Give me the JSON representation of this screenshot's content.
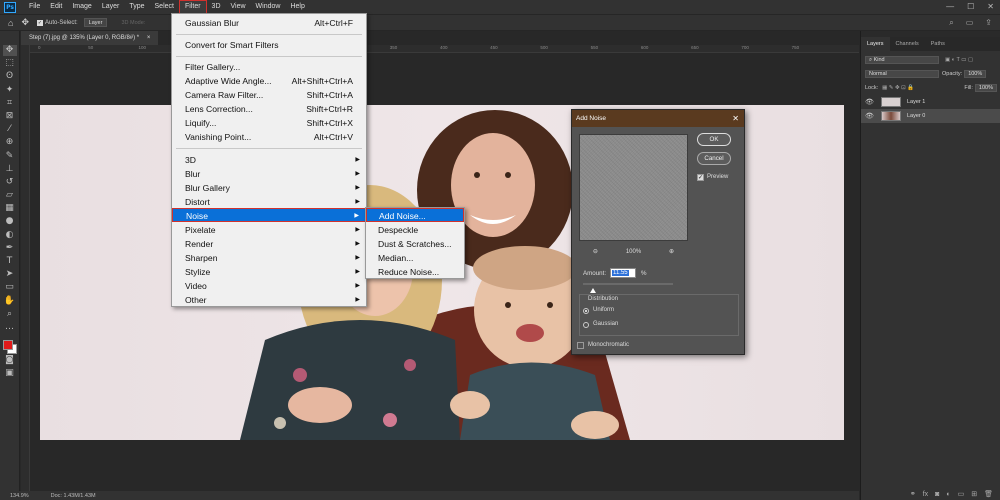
{
  "app": {
    "logo": "Ps"
  },
  "menubar": {
    "items": [
      "File",
      "Edit",
      "Image",
      "Layer",
      "Type",
      "Select",
      "Filter",
      "3D",
      "View",
      "Window",
      "Help"
    ],
    "active": "Filter"
  },
  "window_controls": {
    "minimize": "—",
    "maximize": "☐",
    "close": "✕"
  },
  "options_bar": {
    "auto_select_label": "Auto-Select:",
    "auto_select_target": "Layer",
    "mode_3d_label": "3D Mode:"
  },
  "document": {
    "tab_title": "Step (7).jpg @ 135% (Layer 0, RGB/8#) *",
    "tab_close": "×",
    "ruler_ticks": [
      "0",
      "50",
      "100",
      "150",
      "200",
      "250",
      "300",
      "350",
      "400",
      "450",
      "500",
      "550",
      "600",
      "650",
      "700",
      "750"
    ]
  },
  "status_bar": {
    "zoom": "134.9%",
    "doc_info": "Doc: 1.43M/1.43M"
  },
  "filter_menu": {
    "last_filter": {
      "label": "Gaussian Blur",
      "shortcut": "Alt+Ctrl+F"
    },
    "convert": "Convert for Smart Filters",
    "group1": [
      {
        "label": "Filter Gallery...",
        "shortcut": ""
      },
      {
        "label": "Adaptive Wide Angle...",
        "shortcut": "Alt+Shift+Ctrl+A"
      },
      {
        "label": "Camera Raw Filter...",
        "shortcut": "Shift+Ctrl+A"
      },
      {
        "label": "Lens Correction...",
        "shortcut": "Shift+Ctrl+R"
      },
      {
        "label": "Liquify...",
        "shortcut": "Shift+Ctrl+X"
      },
      {
        "label": "Vanishing Point...",
        "shortcut": "Alt+Ctrl+V"
      }
    ],
    "submenus": [
      "3D",
      "Blur",
      "Blur Gallery",
      "Distort",
      "Noise",
      "Pixelate",
      "Render",
      "Sharpen",
      "Stylize",
      "Video",
      "Other"
    ],
    "highlighted": "Noise"
  },
  "noise_submenu": {
    "items": [
      "Add Noise...",
      "Despeckle",
      "Dust & Scratches...",
      "Median...",
      "Reduce Noise..."
    ],
    "highlighted": "Add Noise..."
  },
  "add_noise_dialog": {
    "title": "Add Noise",
    "close": "✕",
    "ok_label": "OK",
    "cancel_label": "Cancel",
    "preview_label": "Preview",
    "preview_checked": true,
    "zoom_level": "100%",
    "amount_label": "Amount:",
    "amount_value": "11.55",
    "amount_unit": "%",
    "distribution_label": "Distribution",
    "distribution_options": [
      "Uniform",
      "Gaussian"
    ],
    "distribution_selected": "Uniform",
    "monochromatic_label": "Monochromatic",
    "monochromatic_checked": false
  },
  "layers_panel": {
    "tabs": [
      "Layers",
      "Channels",
      "Paths"
    ],
    "active_tab": "Layers",
    "filter_kind": "Kind",
    "blend_mode": "Normal",
    "opacity_label": "Opacity:",
    "opacity_value": "100%",
    "lock_label": "Lock:",
    "fill_label": "Fill:",
    "fill_value": "100%",
    "layers": [
      {
        "name": "Layer 1",
        "selected": false
      },
      {
        "name": "Layer 0",
        "selected": true
      }
    ]
  },
  "colors": {
    "foreground": "#e11a1a",
    "background": "#ffffff",
    "highlight": "#0a70d8",
    "dialog_title": "#5a3a1f"
  }
}
